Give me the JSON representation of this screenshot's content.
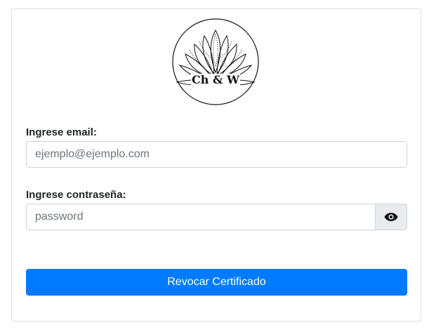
{
  "logo": {
    "text": "Ch & W"
  },
  "form": {
    "email_label": "Ingrese email:",
    "email_placeholder": "ejemplo@ejemplo.com",
    "email_value": "",
    "password_label": "Ingrese contraseña:",
    "password_placeholder": "password",
    "password_value": "",
    "toggle_icon": "eye-icon",
    "submit_label": "Revocar Certificado"
  },
  "colors": {
    "primary": "#007bff",
    "input_border": "#ced4da",
    "addon_bg": "#e9ecef"
  }
}
